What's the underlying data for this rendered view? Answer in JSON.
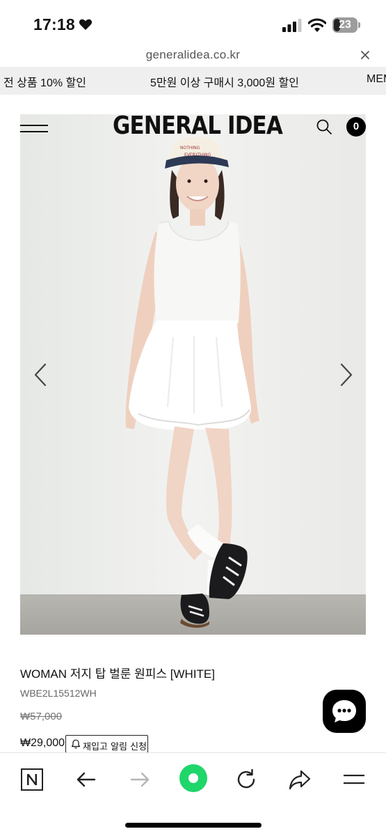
{
  "status_bar": {
    "time": "17:18",
    "battery_level": "23"
  },
  "browser": {
    "url": "generalidea.co.kr"
  },
  "promo": {
    "items": [
      "전 상품 10% 할인",
      "5만원 이상 구매시 3,000원 할인",
      "MEM"
    ]
  },
  "header": {
    "brand": "GENERAL IDEA",
    "cart_count": "0"
  },
  "product": {
    "name": "WOMAN 저지 탑 벌룬 원피스 [WHITE]",
    "code": "WBE2L15512WH",
    "original_price": "₩57,000",
    "sale_price": "₩29,000",
    "restock_label": "재입고 알림 신청",
    "cap_text": "NOTHING EVERYTHING"
  },
  "icons": {
    "heart": "heart-icon",
    "signal": "cellular-signal-icon",
    "wifi": "wifi-icon",
    "close": "close-icon",
    "menu": "hamburger-menu-icon",
    "search": "search-icon",
    "prev": "chevron-left-icon",
    "next": "chevron-right-icon",
    "chat": "chat-bubble-icon",
    "bell": "bell-icon",
    "naver": "naver-n-icon",
    "back": "back-arrow-icon",
    "forward": "forward-arrow-icon",
    "green_dot": "green-dot-icon",
    "reload": "reload-icon",
    "share": "share-icon",
    "toolbar_menu": "toolbar-menu-icon"
  },
  "colors": {
    "promo_background": "#efefef",
    "accent_green": "#1fd66a",
    "chat_button": "#000000"
  }
}
